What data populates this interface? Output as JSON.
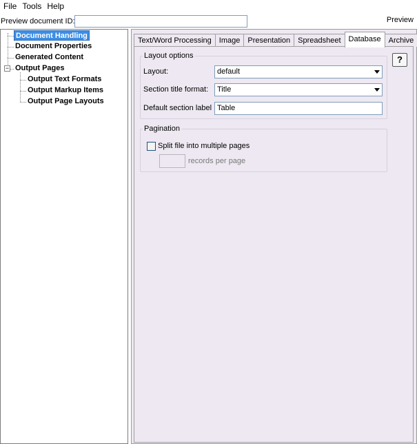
{
  "menu": [
    "File",
    "Tools",
    "Help"
  ],
  "preview": {
    "label": "Preview document ID:",
    "value": "",
    "button": "Preview"
  },
  "tree": {
    "document_handling": "Document Handling",
    "document_properties": "Document Properties",
    "generated_content": "Generated Content",
    "output_pages": "Output Pages",
    "output_text_formats": "Output Text Formats",
    "output_markup_items": "Output Markup Items",
    "output_page_layouts": "Output Page Layouts",
    "output_pages_expander": "−"
  },
  "tabs": [
    "Text/Word Processing",
    "Image",
    "Presentation",
    "Spreadsheet",
    "Database",
    "Archive"
  ],
  "active_tab": "Database",
  "help_button": "?",
  "layout_options": {
    "legend": "Layout options",
    "layout_label": "Layout:",
    "layout_value": "default",
    "section_title_label": "Section title format:",
    "section_title_value": "Title",
    "default_section_label": "Default section label",
    "default_section_value": "Table"
  },
  "pagination": {
    "legend": "Pagination",
    "split_label": "Split file into multiple pages",
    "split_checked": false,
    "records_value": "",
    "records_label": "records per page"
  },
  "colors": {
    "selection": "#3d8ee6",
    "panel_bg": "#ede8f1"
  }
}
